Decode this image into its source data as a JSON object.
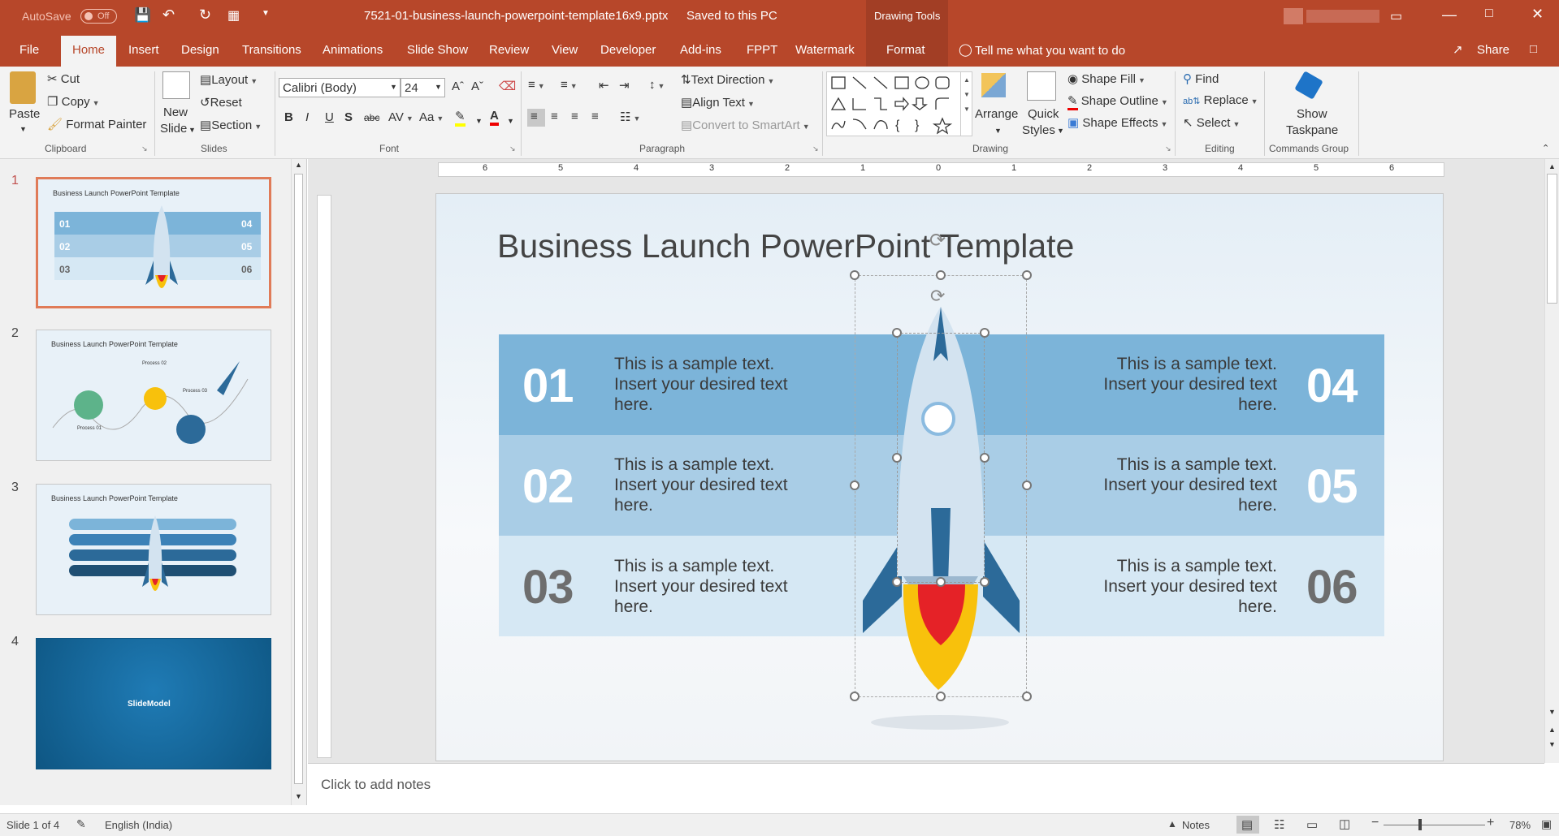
{
  "titlebar": {
    "autosave_label": "AutoSave",
    "autosave_state": "Off",
    "filename": "7521-01-business-launch-powerpoint-template16x9.pptx",
    "save_status": "Saved to this PC",
    "context_tools": "Drawing Tools"
  },
  "menu": {
    "tabs": [
      "File",
      "Home",
      "Insert",
      "Design",
      "Transitions",
      "Animations",
      "Slide Show",
      "Review",
      "View",
      "Developer",
      "Add-ins",
      "FPPT",
      "Watermark",
      "Format"
    ],
    "tell_me": "Tell me what you want to do",
    "share": "Share"
  },
  "ribbon": {
    "clipboard": {
      "paste": "Paste",
      "cut": "Cut",
      "copy": "Copy",
      "format_painter": "Format Painter",
      "label": "Clipboard"
    },
    "slides": {
      "new_slide_1": "New",
      "new_slide_2": "Slide",
      "layout": "Layout",
      "reset": "Reset",
      "section": "Section",
      "label": "Slides"
    },
    "font": {
      "name": "Calibri (Body)",
      "size": "24",
      "label": "Font"
    },
    "paragraph": {
      "text_direction": "Text Direction",
      "align_text": "Align Text",
      "smartart": "Convert to SmartArt",
      "label": "Paragraph"
    },
    "drawing": {
      "arrange": "Arrange",
      "quick_styles_1": "Quick",
      "quick_styles_2": "Styles",
      "shape_fill": "Shape Fill",
      "shape_outline": "Shape Outline",
      "shape_effects": "Shape Effects",
      "label": "Drawing"
    },
    "editing": {
      "find": "Find",
      "replace": "Replace",
      "select": "Select",
      "label": "Editing"
    },
    "commands": {
      "show_1": "Show",
      "show_2": "Taskpane",
      "label": "Commands Group"
    }
  },
  "thumbnails": {
    "numbers": [
      "1",
      "2",
      "3",
      "4"
    ],
    "title": "Business Launch PowerPoint Template",
    "brand": "SlideModel",
    "process": [
      "Process 01",
      "Process 02",
      "Process 03"
    ],
    "sample": "This is a sample text. Insert your desired text here."
  },
  "ruler": {
    "h_ticks": [
      "6",
      "5",
      "4",
      "3",
      "2",
      "1",
      "0",
      "1",
      "2",
      "3",
      "4",
      "5",
      "6"
    ]
  },
  "slide": {
    "title": "Business Launch PowerPoint Template",
    "left": [
      {
        "num": "01",
        "line1": "This is a sample text.",
        "line2": "Insert your desired text",
        "line3": "here."
      },
      {
        "num": "02",
        "line1": "This is a sample text.",
        "line2": "Insert your desired text",
        "line3": "here."
      },
      {
        "num": "03",
        "line1": "This is a sample text.",
        "line2": "Insert your desired text",
        "line3": "here."
      }
    ],
    "right": [
      {
        "num": "04",
        "line1": "This is a sample text.",
        "line2": "Insert your desired text",
        "line3": "here."
      },
      {
        "num": "05",
        "line1": "This is a sample text.",
        "line2": "Insert your desired text",
        "line3": "here."
      },
      {
        "num": "06",
        "line1": "This is a sample text.",
        "line2": "Insert your desired text",
        "line3": "here."
      }
    ],
    "colors": {
      "band1": "#7cb4d9",
      "band2": "#a9cde6",
      "band3": "#d6e8f4"
    }
  },
  "notes": {
    "placeholder": "Click to add notes"
  },
  "status": {
    "slide": "Slide 1 of 4",
    "language": "English (India)",
    "notes": "Notes",
    "zoom": "78%"
  }
}
